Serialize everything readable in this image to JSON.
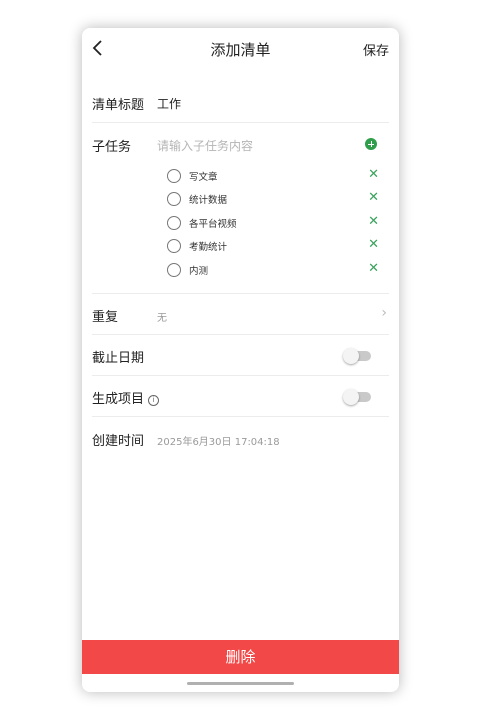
{
  "header": {
    "title": "添加清单",
    "save_label": "保存"
  },
  "list_title": {
    "label": "清单标题",
    "value": "工作"
  },
  "subtasks": {
    "label": "子任务",
    "placeholder": "请输入子任务内容",
    "items": [
      {
        "text": "写文章"
      },
      {
        "text": "统计数据"
      },
      {
        "text": "各平台视频"
      },
      {
        "text": "考勤统计"
      },
      {
        "text": "内测"
      }
    ]
  },
  "repeat": {
    "label": "重复",
    "value": "无"
  },
  "deadline": {
    "label": "截止日期",
    "enabled": false
  },
  "generate_project": {
    "label": "生成项目",
    "info_glyph": "i",
    "enabled": false
  },
  "created_time": {
    "label": "创建时间",
    "value": "2025年6月30日 17:04:18"
  },
  "delete_label": "删除",
  "colors": {
    "accent_green": "#2e9e4a",
    "delete_red": "#f24848"
  }
}
